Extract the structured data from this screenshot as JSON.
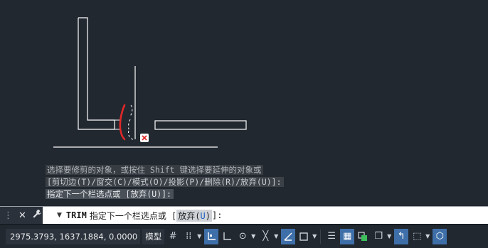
{
  "history": {
    "line1": "选择要修剪的对象，或按住 Shift 键选择要延伸的对象或",
    "line2": "[剪切边(T)/窗交(C)/模式(O)/投影(P)/删除(R)/放弃(U)]:",
    "line3": "指定下一个栏选点或 [放弃(U)]:"
  },
  "command_line": {
    "command": "TRIM",
    "prompt": "指定下一个栏选点或 [",
    "option_label": "放弃(",
    "option_key": "U",
    "option_close": ")",
    "suffix": "]:"
  },
  "icons": {
    "close": "close-icon",
    "customize": "wrench-icon",
    "grip": "grip-icon"
  },
  "status_bar": {
    "coordinates": "2975.3793, 1637.1884, 0.0000",
    "model_tab": "模型",
    "buttons": [
      "grid-icon",
      "snap-icon",
      "ortho-icon",
      "polar-icon",
      "osnap-icon",
      "otrack-icon",
      "lineweight-icon",
      "transparency-icon",
      "selection-cycling-icon",
      "3d-osnap-icon",
      "dynamic-ucs-icon",
      "selection-filter-icon",
      "gizmo-icon"
    ]
  },
  "colors": {
    "canvas": "#212830",
    "geometry": "#ffffff",
    "fence_stroke": "#e02828",
    "active_button": "#3f6fa8"
  }
}
